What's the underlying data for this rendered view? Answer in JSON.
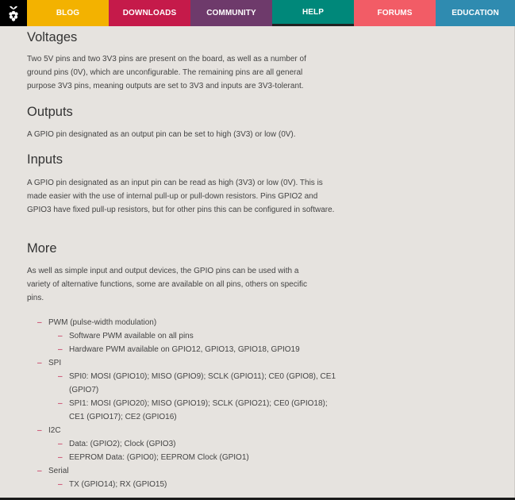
{
  "nav": {
    "items": [
      {
        "label": "BLOG",
        "color": "#f3b200"
      },
      {
        "label": "DOWNLOADS",
        "color": "#c51a4a"
      },
      {
        "label": "COMMUNITY",
        "color": "#6e3a6b"
      },
      {
        "label": "HELP",
        "color": "#00887a",
        "active": true
      },
      {
        "label": "FORUMS",
        "color": "#f25c66"
      },
      {
        "label": "EDUCATION",
        "color": "#2f8bb0"
      }
    ],
    "logo_icon": "raspberry-logo-icon"
  },
  "sections": {
    "voltages": {
      "heading": "Voltages",
      "body": "Two 5V pins and two 3V3 pins are present on the board, as well as a number of ground pins (0V), which are unconfigurable. The remaining pins are all general purpose 3V3 pins, meaning outputs are set to 3V3 and inputs are 3V3-tolerant."
    },
    "outputs": {
      "heading": "Outputs",
      "body": "A GPIO pin designated as an output pin can be set to high (3V3) or low (0V)."
    },
    "inputs": {
      "heading": "Inputs",
      "body": "A GPIO pin designated as an input pin can be read as high (3V3) or low (0V). This is made easier with the use of internal pull-up or pull-down resistors. Pins GPIO2 and GPIO3 have fixed pull-up resistors, but for other pins this can be configured in software."
    },
    "more": {
      "heading": "More",
      "body": "As well as simple input and output devices, the GPIO pins can be used with a variety of alternative functions, some are available on all pins, others on specific pins."
    }
  },
  "functions": [
    {
      "label": "PWM (pulse-width modulation)",
      "items": [
        "Software PWM available on all pins",
        "Hardware PWM available on GPIO12, GPIO13, GPIO18, GPIO19"
      ]
    },
    {
      "label": "SPI",
      "items": [
        "SPI0: MOSI (GPIO10); MISO (GPIO9); SCLK (GPIO11); CE0 (GPIO8), CE1 (GPIO7)",
        "SPI1: MOSI (GPIO20); MISO (GPIO19); SCLK (GPIO21); CE0 (GPIO18); CE1 (GPIO17); CE2 (GPIO16)"
      ]
    },
    {
      "label": "I2C",
      "items": [
        "Data: (GPIO2); Clock (GPIO3)",
        "EEPROM Data: (GPIO0); EEPROM Clock (GPIO1)"
      ]
    },
    {
      "label": "Serial",
      "items": [
        "TX (GPIO14); RX (GPIO15)"
      ]
    }
  ],
  "dash_glyph": "–"
}
